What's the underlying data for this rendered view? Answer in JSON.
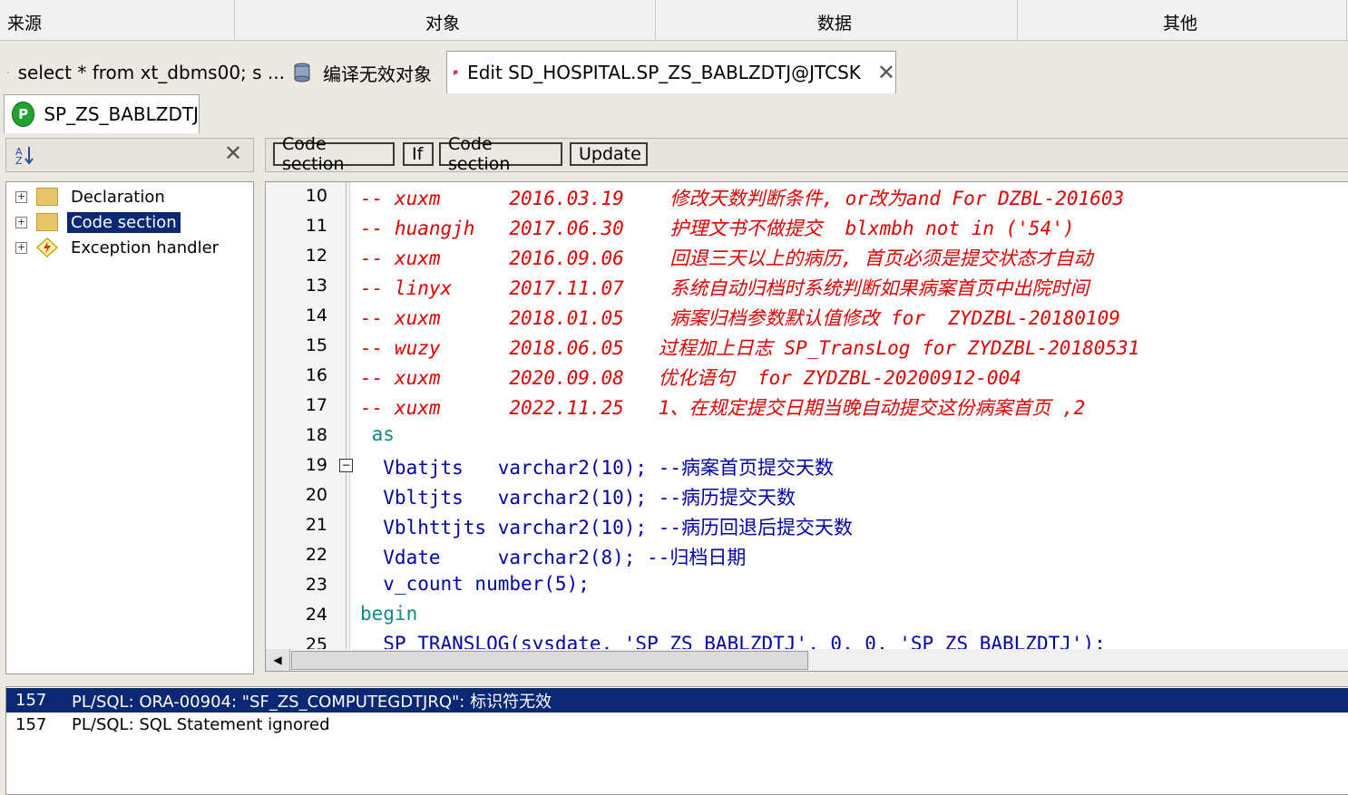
{
  "header": {
    "columns": [
      "来源",
      "对象",
      "数据",
      "其他"
    ]
  },
  "tabs": [
    {
      "label": "select * from xt_dbms00; s ...",
      "icon": "sql-window-icon"
    },
    {
      "label": "编译无效对象",
      "icon": "database-icon"
    },
    {
      "label": "Edit SD_HOSPITAL.SP_ZS_BABLZDTJ@JTCSK",
      "icon": "program-window-icon",
      "active": true
    }
  ],
  "subtab": {
    "badge": "P",
    "label": "SP_ZS_BABLZDTJ"
  },
  "tree": {
    "items": [
      {
        "label": "Declaration",
        "icon": "folder-icon",
        "selected": false
      },
      {
        "label": "Code section",
        "icon": "folder-icon",
        "selected": true
      },
      {
        "label": "Exception handler",
        "icon": "exception-icon",
        "selected": false
      }
    ]
  },
  "breadcrumb": [
    "Code section",
    "If",
    "Code section",
    "Update"
  ],
  "code": [
    {
      "n": "10",
      "text": "-- xuxm      2016.03.19    修改天数判断条件, or改为and For DZBL-201603"
    },
    {
      "n": "11",
      "text": "-- huangjh   2017.06.30    护理文书不做提交  blxmbh not in ('54')"
    },
    {
      "n": "12",
      "text": "-- xuxm      2016.09.06    回退三天以上的病历, 首页必须是提交状态才自动"
    },
    {
      "n": "13",
      "text": "-- linyx     2017.11.07    系统自动归档时系统判断如果病案首页中出院时间"
    },
    {
      "n": "14",
      "text": "-- xuxm      2018.01.05    病案归档参数默认值修改 for  ZYDZBL-20180109"
    },
    {
      "n": "15",
      "text": "-- wuzy      2018.06.05   过程加上日志 SP_TransLog for ZYDZBL-20180531"
    },
    {
      "n": "16",
      "text": "-- xuxm      2020.09.08   优化语句  for ZYDZBL-20200912-004"
    },
    {
      "n": "17",
      "text": "-- xuxm      2022.11.25   1、在规定提交日期当晚自动提交这份病案首页 ,2"
    },
    {
      "n": "18",
      "text": " as"
    },
    {
      "n": "19",
      "text": "  Vbatjts   varchar2(10); --病案首页提交天数"
    },
    {
      "n": "20",
      "text": "  Vbltjts   varchar2(10); --病历提交天数"
    },
    {
      "n": "21",
      "text": "  Vblhttjts varchar2(10); --病历回退后提交天数"
    },
    {
      "n": "22",
      "text": "  Vdate     varchar2(8); --归档日期"
    },
    {
      "n": "23",
      "text": "  v_count number(5);"
    },
    {
      "n": "24",
      "text": "begin"
    },
    {
      "n": "25",
      "text": "  SP_TRANSLOG(sysdate, 'SP_ZS_BABLZDTJ', 0, 0, 'SP_ZS_BABLZDTJ');"
    }
  ],
  "messages": [
    {
      "n": "157",
      "text": "PL/SQL: ORA-00904: \"SF_ZS_COMPUTEGDTJRQ\": 标识符无效",
      "selected": true
    },
    {
      "n": "157",
      "text": "PL/SQL: SQL Statement ignored",
      "selected": false
    }
  ],
  "colors": {
    "comment": "#e00000",
    "keyword": "#0e8a8a",
    "selection": "#0a2873",
    "number": "#0000ff"
  }
}
